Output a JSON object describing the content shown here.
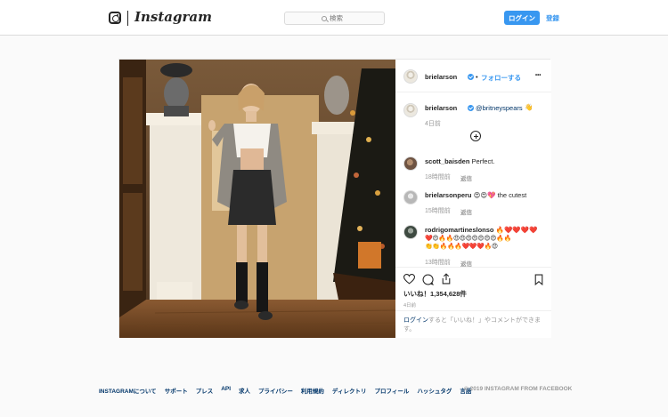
{
  "header": {
    "wordmark": "Instagram",
    "search_placeholder": "検索",
    "login_label": "ログイン",
    "signup_label": "登録"
  },
  "post": {
    "author": "brielarson",
    "follow_separator": "•",
    "follow_label": "フォローする",
    "more_label": "•••",
    "caption": {
      "username": "brielarson",
      "mention": "@britneyspears",
      "emoji": "👋",
      "time": "4日前"
    },
    "comments": [
      {
        "username": "scott_baisden",
        "text": "Perfect.",
        "time": "18時間前",
        "reply_label": "返信"
      },
      {
        "username": "brielarsonperu",
        "text": "😍😍💖 the cutest",
        "time": "15時間前",
        "reply_label": "返信"
      },
      {
        "username": "rodrigomartineslonso",
        "emoji_line1": "🔥❤️❤️❤️❤️",
        "emoji_line2": "❤️😍🔥🔥😍😍😍😍😍😍😍🔥🔥",
        "emoji_line3": "👏👏🔥🔥🔥❤️❤️❤️🔥😍",
        "time": "13時間前",
        "reply_label": "返信"
      }
    ],
    "likes": "いいね！1,354,628件",
    "post_time": "4日前",
    "login_prompt": {
      "link": "ログイン",
      "rest": "すると「いいね！」やコメントができます。"
    }
  },
  "footer": {
    "links": [
      "INSTAGRAMについて",
      "サポート",
      "プレス",
      "API",
      "求人",
      "プライバシー",
      "利用規約",
      "ディレクトリ",
      "プロフィール",
      "ハッシュタグ",
      "言語"
    ],
    "copyright": "© 2019 INSTAGRAM FROM FACEBOOK"
  },
  "colors": {
    "accent": "#3897f0",
    "link_dark": "#003569",
    "muted": "#999999"
  }
}
